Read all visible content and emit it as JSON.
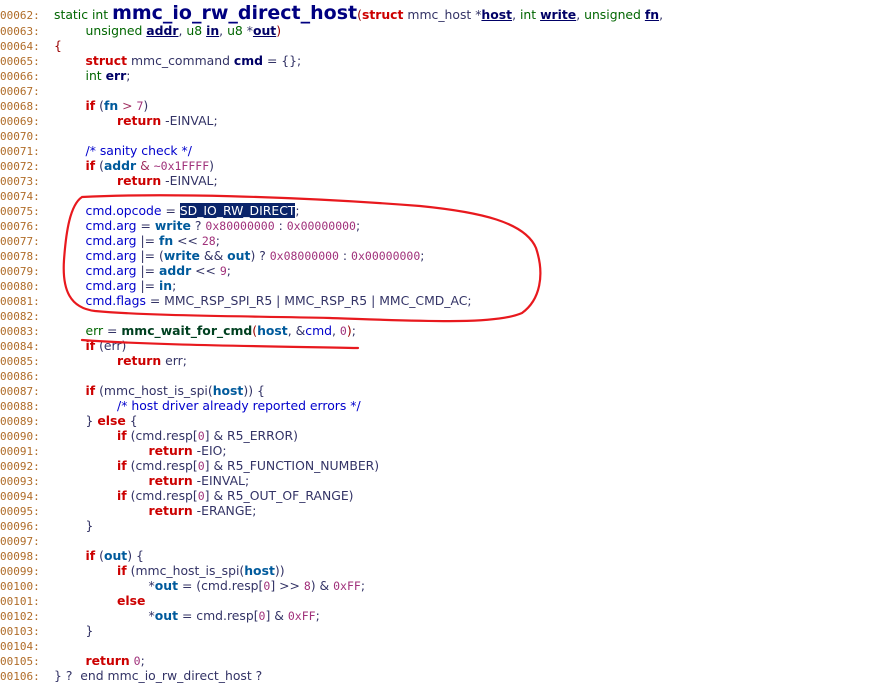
{
  "lines": [
    {
      "n": "00062:",
      "html": "<span class='ty'>static int </span><span class='fnbig'>mmc_io_rw_direct_host</span><span class='paren'>(</span><span class='kw'>struct</span> mmc_host *<span class='hl'>host</span>, <span class='ty'>int</span> <span class='hl'>write</span>, <span class='ty'>unsigned</span> <span class='hl'>fn</span>,"
    },
    {
      "n": "00063:",
      "html": "        <span class='ty'>unsigned</span> <span class='hl'>addr</span>, <span class='ty'>u8</span> <span class='hl'>in</span>, <span class='ty'>u8</span> *<span class='hl'>out</span><span class='paren'>)</span>"
    },
    {
      "n": "00064:",
      "html": "<span class='paren'>{</span>"
    },
    {
      "n": "00065:",
      "html": "        <span class='kw'>struct</span> mmc_command <span class='fn'>cmd</span> = {};"
    },
    {
      "n": "00066:",
      "html": "        <span class='ty'>int</span> <span class='fn'>err</span>;"
    },
    {
      "n": "00067:",
      "html": ""
    },
    {
      "n": "00068:",
      "html": "        <span class='kw'>if</span> (<span class='vb'>fn</span> <span class='op'>&gt;</span> <span class='num'>7</span>)"
    },
    {
      "n": "00069:",
      "html": "                <span class='kw'>return</span> -EINVAL;"
    },
    {
      "n": "00070:",
      "html": ""
    },
    {
      "n": "00071:",
      "html": "        <span class='cm'>/* sanity check */</span>"
    },
    {
      "n": "00072:",
      "html": "        <span class='kw'>if</span> (<span class='vb'>addr</span> <span class='op'>&amp;</span> <span class='num'>~0x1FFFF</span>)"
    },
    {
      "n": "00073:",
      "html": "                <span class='kw'>return</span> -EINVAL;"
    },
    {
      "n": "00074:",
      "html": ""
    },
    {
      "n": "00075:",
      "html": "        <span class='cm'>cmd.opcode</span> = <span class='sel'>SD_IO_RW_DIRECT</span>;"
    },
    {
      "n": "00076:",
      "html": "        <span class='cm'>cmd.arg</span> = <span class='vb'>write</span> ? <span class='num'>0x80000000</span> : <span class='num'>0x00000000</span>;"
    },
    {
      "n": "00077:",
      "html": "        <span class='cm'>cmd.arg</span> |= <span class='vb'>fn</span> &lt;&lt; <span class='num'>28</span>;"
    },
    {
      "n": "00078:",
      "html": "        <span class='cm'>cmd.arg</span> |= (<span class='vb'>write</span> &amp;&amp; <span class='vb'>out</span>) ? <span class='num'>0x08000000</span> : <span class='num'>0x00000000</span>;"
    },
    {
      "n": "00079:",
      "html": "        <span class='cm'>cmd.arg</span> |= <span class='vb'>addr</span> &lt;&lt; <span class='num'>9</span>;"
    },
    {
      "n": "00080:",
      "html": "        <span class='cm'>cmd.arg</span> |= <span class='vb'>in</span>;"
    },
    {
      "n": "00081:",
      "html": "        <span class='cm'>cmd.flags</span> = MMC_RSP_SPI_R5 | MMC_RSP_R5 | MMC_CMD_AC;"
    },
    {
      "n": "00082:",
      "html": ""
    },
    {
      "n": "00083:",
      "html": "        <span class='ty'>err</span> = <span class='mac'>mmc_wait_for_cmd</span><span class='paren'>(</span><span class='vb'>host</span>, &amp;<span class='cm'>cmd</span>, <span class='num'>0</span><span class='paren'>)</span>;"
    },
    {
      "n": "00084:",
      "html": "        <span class='kw'>if</span> (err)"
    },
    {
      "n": "00085:",
      "html": "                <span class='kw'>return</span> err;"
    },
    {
      "n": "00086:",
      "html": ""
    },
    {
      "n": "00087:",
      "html": "        <span class='kw'>if</span> (mmc_host_is_spi(<span class='vb'>host</span>)) {"
    },
    {
      "n": "00088:",
      "html": "                <span class='cm'>/* host driver already reported errors */</span>"
    },
    {
      "n": "00089:",
      "html": "        } <span class='kw'>else</span> {"
    },
    {
      "n": "00090:",
      "html": "                <span class='kw'>if</span> (cmd.resp[<span class='num'>0</span>] &amp; R5_ERROR)"
    },
    {
      "n": "00091:",
      "html": "                        <span class='kw'>return</span> -EIO;"
    },
    {
      "n": "00092:",
      "html": "                <span class='kw'>if</span> (cmd.resp[<span class='num'>0</span>] &amp; R5_FUNCTION_NUMBER)"
    },
    {
      "n": "00093:",
      "html": "                        <span class='kw'>return</span> -EINVAL;"
    },
    {
      "n": "00094:",
      "html": "                <span class='kw'>if</span> (cmd.resp[<span class='num'>0</span>] &amp; R5_OUT_OF_RANGE)"
    },
    {
      "n": "00095:",
      "html": "                        <span class='kw'>return</span> -ERANGE;"
    },
    {
      "n": "00096:",
      "html": "        }"
    },
    {
      "n": "00097:",
      "html": ""
    },
    {
      "n": "00098:",
      "html": "        <span class='kw'>if</span> (<span class='vb'>out</span>) {"
    },
    {
      "n": "00099:",
      "html": "                <span class='kw'>if</span> (mmc_host_is_spi(<span class='vb'>host</span>))"
    },
    {
      "n": "00100:",
      "html": "                        *<span class='vb'>out</span> = (cmd.resp[<span class='num'>0</span>] &gt;&gt; <span class='num'>8</span>) &amp; <span class='num'>0xFF</span>;"
    },
    {
      "n": "00101:",
      "html": "                <span class='kw'>else</span>"
    },
    {
      "n": "00102:",
      "html": "                        *<span class='vb'>out</span> = cmd.resp[<span class='num'>0</span>] &amp; <span class='num'>0xFF</span>;"
    },
    {
      "n": "00103:",
      "html": "        }"
    },
    {
      "n": "00104:",
      "html": ""
    },
    {
      "n": "00105:",
      "html": "        <span class='kw'>return</span> <span class='num'>0</span>;"
    },
    {
      "n": "00106:",
      "html": "} ?  end mmc_io_rw_direct_host ?"
    }
  ],
  "annotation_color": "#e8191e"
}
